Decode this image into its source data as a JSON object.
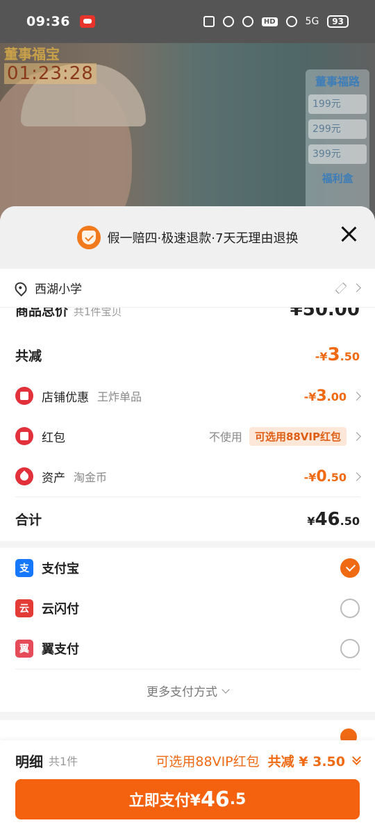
{
  "status_bar": {
    "time": "09:36",
    "network": "5G",
    "battery": "93",
    "hd": "HD"
  },
  "live": {
    "timer_title": "董事福宝",
    "timer": "01:23:28",
    "promo_title": "董事福路",
    "promo_rows": [
      "199元",
      "299元",
      "399元"
    ],
    "promo_footer": "福利盒"
  },
  "sheet": {
    "guarantee": "假一赔四·极速退款·7天无理由退换",
    "address": "西湖小学",
    "goods_total": {
      "label": "商品总价",
      "sub": "共1件宝贝",
      "amount": "¥50.00"
    },
    "discount": {
      "label": "共减",
      "prefix": "-¥",
      "int": "3",
      "dec": ".50"
    },
    "rows": [
      {
        "label": "店铺优惠",
        "detail": "王炸单品",
        "prefix": "-¥",
        "int": "3",
        "dec": ".00"
      },
      {
        "label": "红包",
        "unused": "不使用",
        "vip": "可选用88VIP红包"
      },
      {
        "label": "资产",
        "detail": "淘金币",
        "prefix": "-¥",
        "int": "0",
        "dec": ".50"
      }
    ],
    "total": {
      "label": "合计",
      "prefix": "¥",
      "int": "46",
      "dec": ".50"
    },
    "payments": [
      {
        "name": "支付宝",
        "logo": "支",
        "color": "#1677ff",
        "selected": true
      },
      {
        "name": "云闪付",
        "logo": "云",
        "color": "#e33b36",
        "selected": false
      },
      {
        "name": "翼支付",
        "logo": "翼",
        "color": "#e64b5a",
        "selected": false
      }
    ],
    "more_payments": "更多支付方式"
  },
  "footer": {
    "detail_label": "明细",
    "count": "共1件",
    "vip_text": "可选用88VIP红包",
    "savings": "共减 ¥ 3.50",
    "pay_button": {
      "text": "立即支付¥",
      "int": "46",
      "dec": ".5"
    }
  }
}
